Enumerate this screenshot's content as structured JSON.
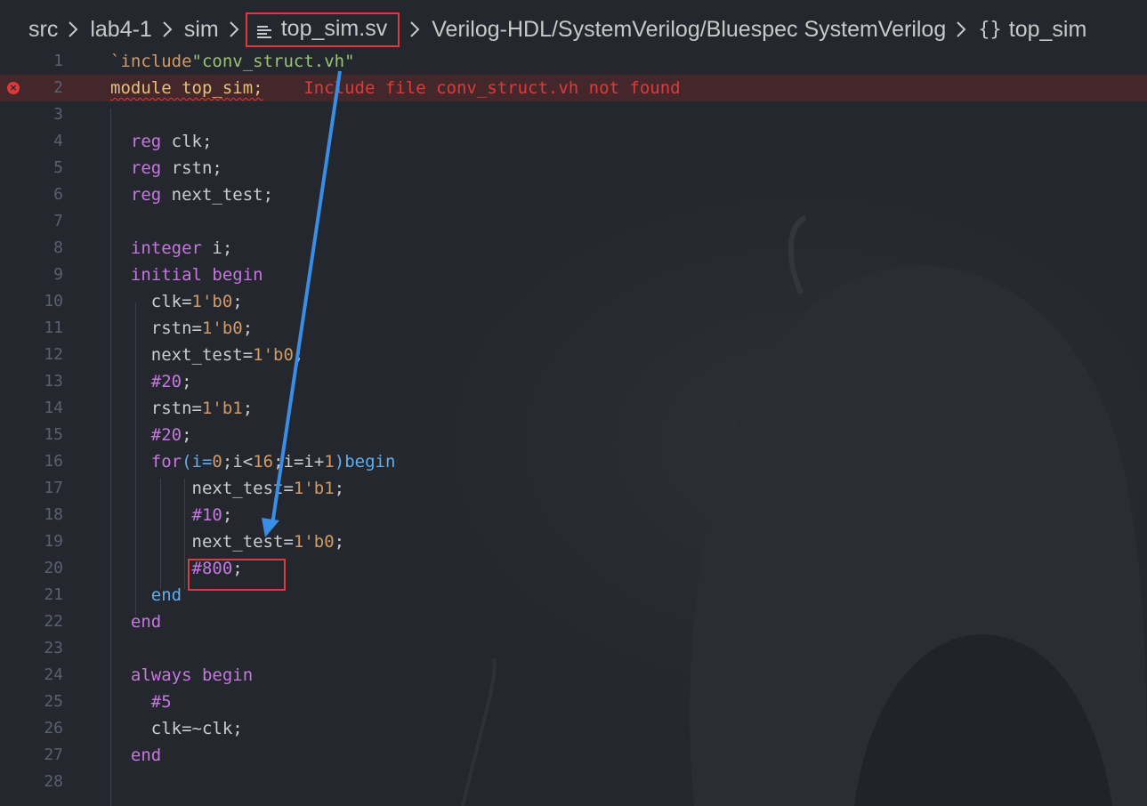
{
  "breadcrumb": {
    "items": [
      "src",
      "lab4-1",
      "sim"
    ],
    "file": "top_sim.sv",
    "language": "Verilog-HDL/SystemVerilog/Bluespec SystemVerilog",
    "symbol": "top_sim",
    "symbol_icon": "{}"
  },
  "editor": {
    "lines": [
      {
        "n": "1"
      },
      {
        "n": "2"
      },
      {
        "n": "3"
      },
      {
        "n": "4"
      },
      {
        "n": "5"
      },
      {
        "n": "6"
      },
      {
        "n": "7"
      },
      {
        "n": "8"
      },
      {
        "n": "9"
      },
      {
        "n": "10"
      },
      {
        "n": "11"
      },
      {
        "n": "12"
      },
      {
        "n": "13"
      },
      {
        "n": "14"
      },
      {
        "n": "15"
      },
      {
        "n": "16"
      },
      {
        "n": "17"
      },
      {
        "n": "18"
      },
      {
        "n": "19"
      },
      {
        "n": "20"
      },
      {
        "n": "21"
      },
      {
        "n": "22"
      },
      {
        "n": "23"
      },
      {
        "n": "24"
      },
      {
        "n": "25"
      },
      {
        "n": "26"
      },
      {
        "n": "27"
      },
      {
        "n": "28"
      }
    ],
    "code": {
      "l1_include": "`include",
      "l1_file": "\"conv_struct.vh\"",
      "l2_module": "module top_sim;",
      "l2_error": "Include file conv_struct.vh not found",
      "l4_kw": "reg",
      "l4_rest": " clk;",
      "l5_kw": "reg",
      "l5_rest": " rstn;",
      "l6_kw": "reg",
      "l6_rest": " next_test;",
      "l8_kw": "integer",
      "l8_rest": " i;",
      "l9_kw": "initial",
      "l9_begin": "begin",
      "l10_id": "clk=",
      "l10_val": "1'b0",
      "l10_end": ";",
      "l11_id": "rstn=",
      "l11_val": "1'b0",
      "l11_end": ";",
      "l12_id": "next_test=",
      "l12_val": "1'b0",
      "l12_end": ";",
      "l13_val": "#20",
      "l13_end": ";",
      "l14_id": "rstn=",
      "l14_val": "1'b1",
      "l14_end": ";",
      "l15_val": "#20",
      "l15_end": ";",
      "l16_for": "for",
      "l16_a": "(i=",
      "l16_b": "0",
      "l16_c": ";i<",
      "l16_d": "16",
      "l16_e": ";i=i+",
      "l16_f": "1",
      "l16_g": ")",
      "l16_begin": "begin",
      "l17_id": "next_test=",
      "l17_val": "1'b1",
      "l17_end": ";",
      "l18_val": "#10",
      "l18_end": ";",
      "l19_id": "next_test=",
      "l19_val": "1'b0",
      "l19_end": ";",
      "l20_val": "#800",
      "l20_end": ";",
      "l21_end": "end",
      "l22_end": "end",
      "l24_kw": "always",
      "l24_begin": "begin",
      "l25_val": "#5",
      "l26_code": "clk=~clk;",
      "l27_end": "end"
    }
  },
  "colors": {
    "background": "#24272d",
    "keyword": "#c777e0",
    "keyword_blue": "#61aeee",
    "number": "#d19a66",
    "string": "#98c379",
    "error": "#e0393a",
    "annotation_arrow": "#3a8ee6"
  }
}
